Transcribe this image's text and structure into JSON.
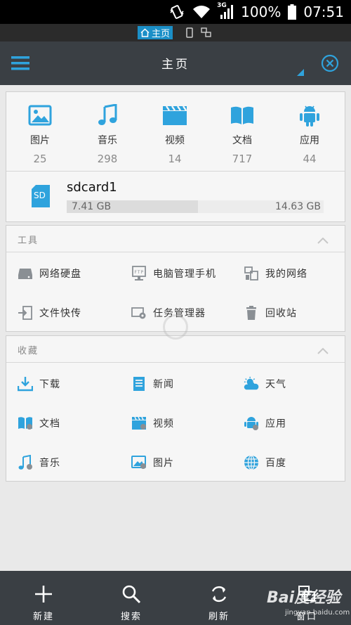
{
  "status_bar": {
    "network": "3G",
    "battery": "100%",
    "time": "07:51"
  },
  "window_strip": {
    "active_tab": "主页"
  },
  "toolbar": {
    "title": "主页"
  },
  "categories": [
    {
      "label": "图片",
      "count": "25",
      "icon": "picture-icon"
    },
    {
      "label": "音乐",
      "count": "298",
      "icon": "music-icon"
    },
    {
      "label": "视频",
      "count": "14",
      "icon": "video-icon"
    },
    {
      "label": "文档",
      "count": "717",
      "icon": "document-icon"
    },
    {
      "label": "应用",
      "count": "44",
      "icon": "android-icon"
    }
  ],
  "storage": {
    "icon_text": "SD",
    "name": "sdcard1",
    "used": "7.41 GB",
    "total": "14.63 GB",
    "used_fraction": 0.51
  },
  "tools": {
    "title": "工具",
    "items": [
      {
        "label": "网络硬盘",
        "icon": "network-disk-icon"
      },
      {
        "label": "电脑管理手机",
        "icon": "ftp-icon"
      },
      {
        "label": "我的网络",
        "icon": "my-network-icon"
      },
      {
        "label": "文件快传",
        "icon": "file-transfer-icon"
      },
      {
        "label": "任务管理器",
        "icon": "task-manager-icon"
      },
      {
        "label": "回收站",
        "icon": "recycle-bin-icon"
      }
    ]
  },
  "favorites": {
    "title": "收藏",
    "items": [
      {
        "label": "下载",
        "icon": "download-icon"
      },
      {
        "label": "新闻",
        "icon": "news-icon"
      },
      {
        "label": "天气",
        "icon": "weather-icon"
      },
      {
        "label": "文档",
        "icon": "document-icon"
      },
      {
        "label": "视频",
        "icon": "video-icon"
      },
      {
        "label": "应用",
        "icon": "android-icon"
      },
      {
        "label": "音乐",
        "icon": "music-icon"
      },
      {
        "label": "图片",
        "icon": "picture-icon"
      },
      {
        "label": "百度",
        "icon": "globe-icon"
      }
    ]
  },
  "bottom_bar": {
    "new": "新建",
    "search": "搜索",
    "refresh": "刷新",
    "windows": "窗口"
  },
  "watermark": {
    "main": "Bai度经验",
    "sub": "jingyan.baidu.com"
  },
  "colors": {
    "accent": "#2fa3dd",
    "bar": "#3a3f44"
  }
}
